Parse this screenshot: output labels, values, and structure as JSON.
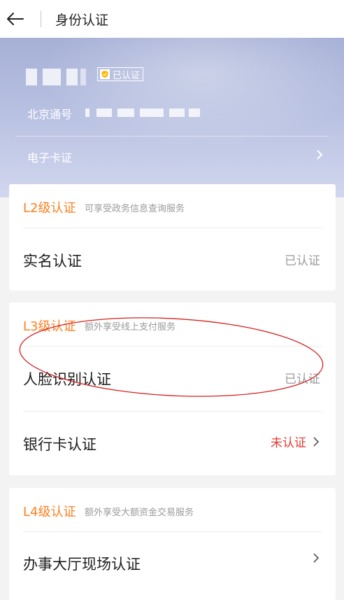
{
  "header": {
    "title": "身份认证",
    "back_icon": "arrow-left-icon"
  },
  "profile": {
    "verified_badge": "已认证",
    "account_label": "北京通号",
    "ecard_label": "电子卡证"
  },
  "levels": [
    {
      "level": "L2级认证",
      "description": "可享受政务信息查询服务",
      "items": [
        {
          "label": "实名认证",
          "status": "已认证"
        }
      ]
    },
    {
      "level": "L3级认证",
      "description": "额外享受线上支付服务",
      "items": [
        {
          "label": "人脸识别认证",
          "status": "已认证"
        },
        {
          "label": "银行卡认证",
          "status": "未认证"
        }
      ]
    },
    {
      "level": "L4级认证",
      "description": "额外享受大额资金交易服务",
      "items": [
        {
          "label": "办事大厅现场认证",
          "status": ""
        }
      ]
    }
  ],
  "colors": {
    "level_orange": "#ff7f1f",
    "unverified_red": "#e53935",
    "annotation_red": "#d62020"
  }
}
